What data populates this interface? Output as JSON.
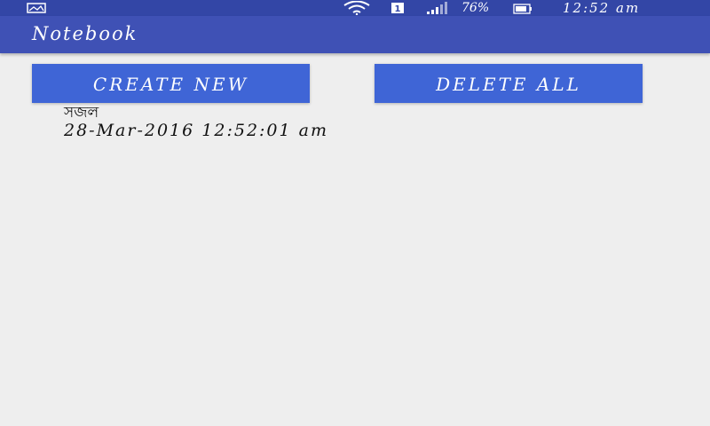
{
  "status_bar": {
    "left_icon": "image-notification-icon",
    "wifi_icon": "wifi-icon",
    "sim_label": "1",
    "signal_icon": "signal-icon",
    "battery_percent": "76%",
    "battery_icon": "battery-icon",
    "time": "12:52 am"
  },
  "app_bar": {
    "title": "Notebook"
  },
  "actions": {
    "create_label": "CREATE NEW",
    "delete_label": "DELETE ALL"
  },
  "notes": [
    {
      "title": "সজল",
      "date": "28-Mar-2016 12:52:01 am"
    }
  ],
  "colors": {
    "status_bar": "#3346a6",
    "app_bar": "#3f51b5",
    "button": "#3f65d6",
    "background": "#eeeeee"
  }
}
